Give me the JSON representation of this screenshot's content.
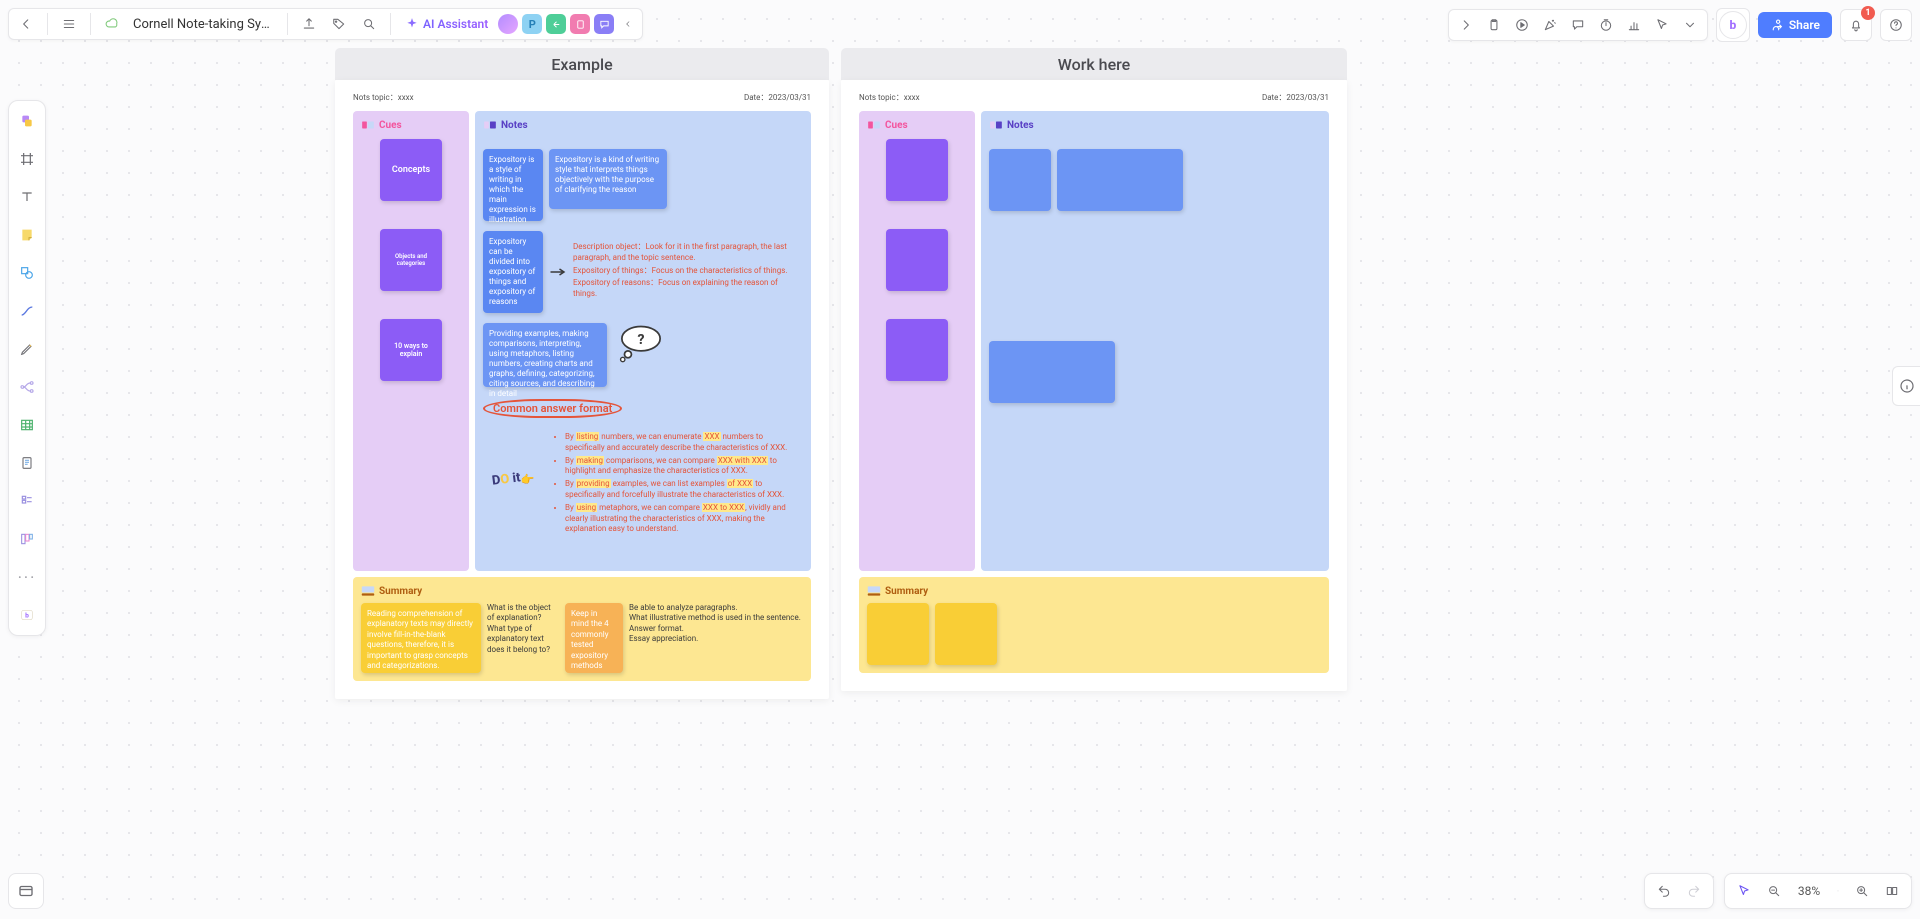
{
  "app": {
    "doc_title": "Cornell Note-taking Syst…",
    "ai_label": "AI Assistant",
    "share_label": "Share",
    "notifications_count": "1",
    "zoom_level": "38%"
  },
  "floating_chips": [
    "P"
  ],
  "boards": {
    "example": {
      "title": "Example",
      "meta_topic_label": "Nots topic：",
      "meta_topic_value": "xxxx",
      "meta_date_label": "Date：",
      "meta_date_value": "2023/03/31",
      "cues_label": "Cues",
      "notes_label": "Notes",
      "cues": [
        "Concepts",
        "Objects and categories",
        "10 ways to explain"
      ],
      "notes_a1": "Expository is a style of writing in which the main expression is illustration",
      "notes_a2": "Expository is a kind of writing style that interprets things objectively with the purpose of clarifying the reason",
      "notes_b1": "Expository can be divided into expository of things and expository of reasons",
      "notes_b2_l1": "Description object：Look for it in the first paragraph, the last paragraph, and the topic sentence.",
      "notes_b2_l2": "Expository of things：Focus on the characteristics of things.",
      "notes_b2_l3": "Expository of reasons：Focus on explaining the reason of things.",
      "notes_c1": "Providing examples, making comparisons, interpreting, using metaphors, listing numbers, creating charts and graphs, defining, categorizing, citing sources, and describing in detail",
      "common_answer_label": "Common answer format",
      "answers": [
        {
          "pre": "By ",
          "hl": "listing",
          "post": " numbers, we can enumerate ",
          "hl2": "XXX",
          "post2": " numbers to specifically and accurately describe the characteristics of XXX."
        },
        {
          "pre": "By ",
          "hl": "making",
          "post": " comparisons, we can compare ",
          "hl2": "XXX with XXX",
          "post2": " to highlight and emphasize the characteristics of XXX."
        },
        {
          "pre": "By ",
          "hl": "providing",
          "post": " examples, we can list examples ",
          "hl2": "of XXX",
          "post2": " to specifically and forcefully illustrate the characteristics of XXX."
        },
        {
          "pre": "By ",
          "hl": "using",
          "post": " metaphors, we can compare ",
          "hl2": "XXX to XXX",
          "post2": ", vividly and clearly illustrating the characteristics of XXX, making the explanation easy to understand."
        }
      ],
      "doit_label": "DO it",
      "summary_label": "Summary",
      "summary_y1": "Reading comprehension of explanatory texts may directly involve fill-in-the-blank questions, therefore, it is important to grasp concepts and categorizations.",
      "summary_t1": "What is the object of explanation?\nWhat type of explanatory text does it belong to?",
      "summary_o1": "Keep in mind the 4 commonly tested expository methods",
      "summary_t2": "Be able to analyze paragraphs.\nWhat illustrative method is used in the sentence.\nAnswer format.\nEssay appreciation."
    },
    "work": {
      "title": "Work here",
      "meta_topic_label": "Nots topic：",
      "meta_topic_value": "xxxx",
      "meta_date_label": "Date：",
      "meta_date_value": "2023/03/31",
      "cues_label": "Cues",
      "notes_label": "Notes",
      "summary_label": "Summary"
    }
  }
}
